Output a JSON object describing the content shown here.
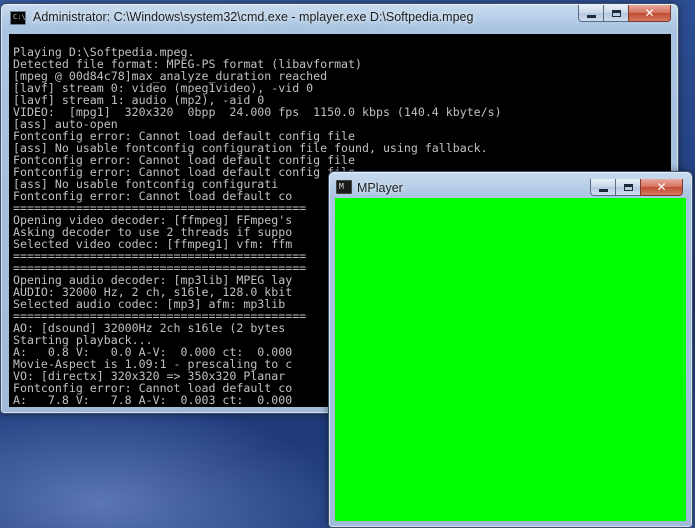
{
  "cmd_window": {
    "title": "Administrator: C:\\Windows\\system32\\cmd.exe - mplayer.exe  D:\\Softpedia.mpeg",
    "icon_text": "C:\\",
    "console_text": "Playing D:\\Softpedia.mpeg.\nDetected file format: MPEG-PS format (libavformat)\n[mpeg @ 00d84c78]max_analyze_duration reached\n[lavf] stream 0: video (mpeg1video), -vid 0\n[lavf] stream 1: audio (mp2), -aid 0\nVIDEO:  [mpg1]  320x320  0bpp  24.000 fps  1150.0 kbps (140.4 kbyte/s)\n[ass] auto-open\nFontconfig error: Cannot load default config file\n[ass] No usable fontconfig configuration file found, using fallback.\nFontconfig error: Cannot load default config file\nFontconfig error: Cannot load default config file\n[ass] No usable fontconfig configurati\nFontconfig error: Cannot load default co\n==========================================\nOpening video decoder: [ffmpeg] FFmpeg's\nAsking decoder to use 2 threads if suppo\nSelected video codec: [ffmpeg1] vfm: ffm\n==========================================\n==========================================\nOpening audio decoder: [mp3lib] MPEG lay\nAUDIO: 32000 Hz, 2 ch, s16le, 128.0 kbit\nSelected audio codec: [mp3] afm: mp3lib\n==========================================\nAO: [dsound] 32000Hz 2ch s16le (2 bytes\nStarting playback...\nA:   0.8 V:   0.0 A-V:  0.000 ct:  0.000\nMovie-Aspect is 1.09:1 - prescaling to c\nVO: [directx] 320x320 => 350x320 Planar\nFontconfig error: Cannot load default co\nA:   7.8 V:   7.8 A-V:  0.003 ct:  0.000"
  },
  "mplayer_window": {
    "title": "MPlayer",
    "icon_text": "M",
    "video_color": "#00ff00"
  },
  "controls": {
    "minimize_icon": "minimize-icon",
    "maximize_icon": "maximize-icon",
    "close_glyph": "✕"
  },
  "colors": {
    "console_bg": "#000000",
    "console_fg": "#c0c0c0",
    "close_button": "#c04b34"
  }
}
